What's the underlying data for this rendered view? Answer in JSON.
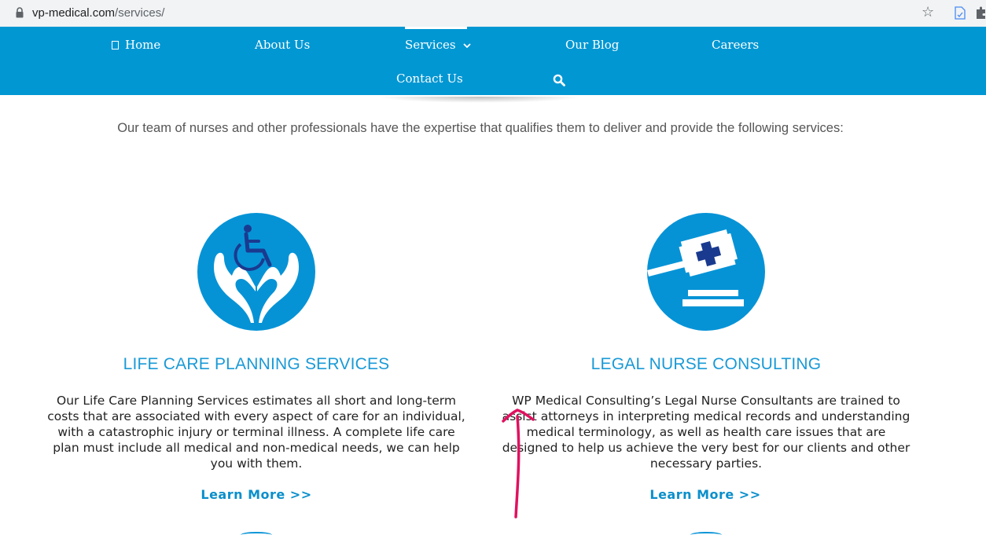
{
  "browser": {
    "url_host": "vp-medical.com",
    "url_path": "/services/"
  },
  "nav": {
    "items": [
      {
        "label": "Home",
        "icon": "home-icon"
      },
      {
        "label": "About Us"
      },
      {
        "label": "Services",
        "active": true
      },
      {
        "label": "Our Blog"
      },
      {
        "label": "Careers"
      },
      {
        "label": "Contact Us"
      }
    ],
    "search_icon": "search-icon"
  },
  "intro": "Our team of nurses and other professionals have the expertise that qualifies them to deliver and provide the following services:",
  "services": [
    {
      "icon": "wheelchair-hands-icon",
      "title": "LIFE CARE PLANNING SERVICES",
      "description": "Our Life Care Planning Services estimates all short and long-term costs that are associated with every aspect of care for an individual, with a catastrophic injury or terminal illness. A complete life care plan must include all medical and non-medical needs, we can help you with them.",
      "link": "Learn More >>"
    },
    {
      "icon": "medical-gavel-icon",
      "title": "LEGAL NURSE CONSULTING",
      "description": "WP Medical Consulting’s Legal Nurse Consultants are trained to assist attorneys in interpreting medical records and understanding medical terminology, as well as health care issues that are designed to help us achieve the very best for our clients and other necessary parties.",
      "link": "Learn More >>"
    }
  ],
  "colors": {
    "nav_bg": "#0097d3",
    "accent": "#1a9ad6",
    "link": "#0b8fcb",
    "annotation": "#e0115f"
  }
}
